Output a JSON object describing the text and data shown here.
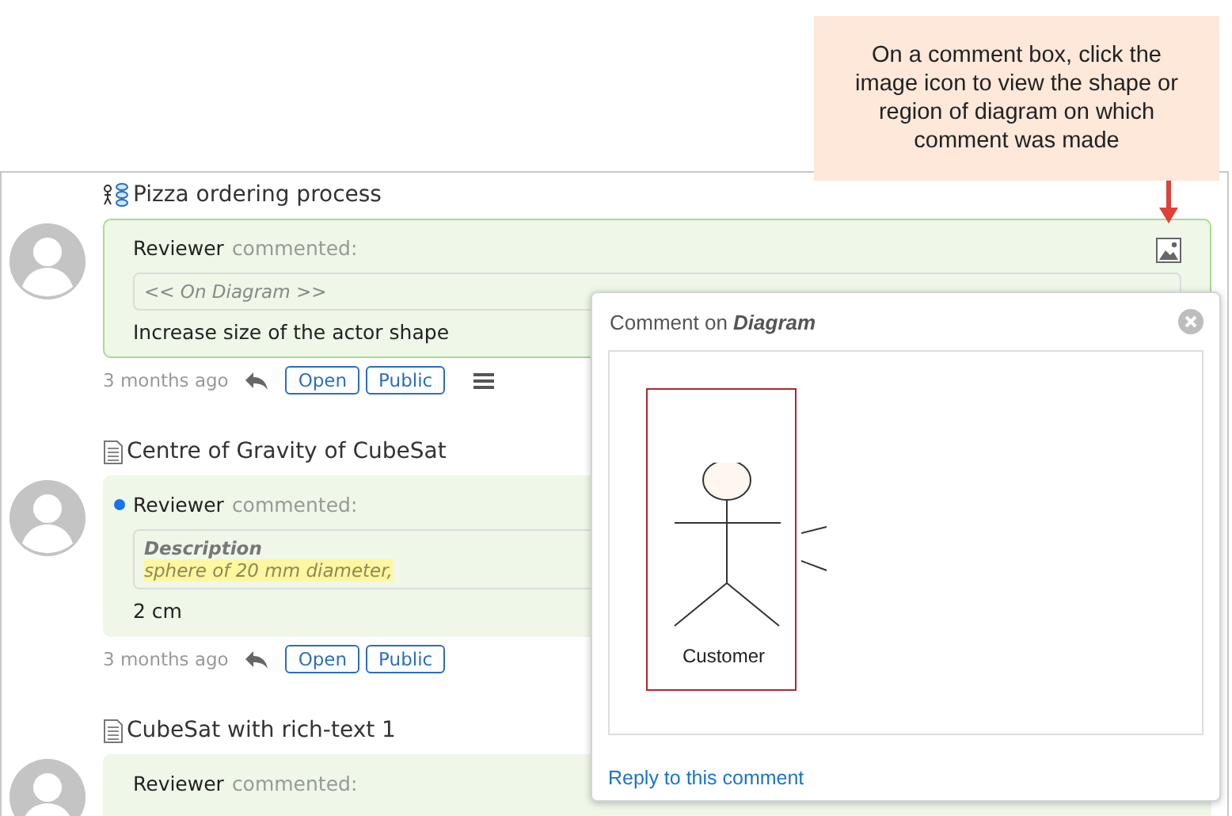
{
  "callout": {
    "text": "On a comment box, click the image icon to view the shape or region of diagram on which comment was made"
  },
  "comments": [
    {
      "kind": "diagram",
      "title": "Pizza ordering process",
      "author": "Reviewer",
      "verb": "commented:",
      "highlighted": true,
      "unread": false,
      "image_button": true,
      "quote": {
        "kind": "context",
        "text": "<< On Diagram >>"
      },
      "body": "Increase size of the actor shape",
      "time": "3 months ago",
      "status": "Open",
      "visibility": "Public",
      "menu": true
    },
    {
      "kind": "document",
      "title": "Centre of Gravity of CubeSat",
      "author": "Reviewer",
      "verb": "commented:",
      "highlighted": false,
      "unread": true,
      "image_button": false,
      "quote": {
        "kind": "field",
        "label": "Description",
        "text": "sphere of 20 mm diameter,"
      },
      "body": "2 cm",
      "time": "3 months ago",
      "status": "Open",
      "visibility": "Public",
      "menu": false
    },
    {
      "kind": "document",
      "title": "CubeSat with rich-text 1",
      "author": "Reviewer",
      "verb": "commented:",
      "highlighted": false,
      "unread": false,
      "image_button": false
    }
  ],
  "popup": {
    "title": "Comment on **Diagram**",
    "actor": {
      "label": "Customer",
      "selected": true
    },
    "link": "Reply to this comment"
  }
}
